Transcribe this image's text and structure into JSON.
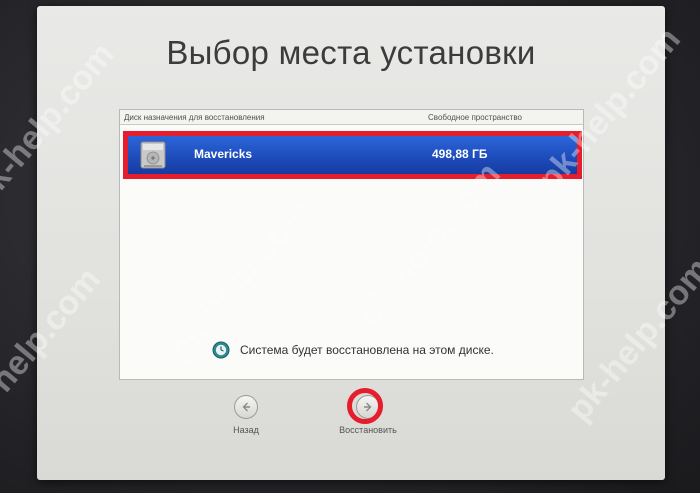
{
  "window": {
    "title": "Выбор места установки"
  },
  "disk_list": {
    "header_disk": "Диск назначения для восстановления",
    "header_free": "Свободное пространство",
    "rows": [
      {
        "name": "Mavericks",
        "free_space": "498,88 ГБ",
        "selected": true,
        "icon": "hard-drive-icon"
      }
    ]
  },
  "status": {
    "icon": "time-machine-icon",
    "text": "Система будет восстановлена на этом диске."
  },
  "navigation": {
    "back_label": "Назад",
    "next_label": "Восстановить"
  },
  "watermark": {
    "text": "pk-help.com"
  },
  "colors": {
    "selection": "#1f4fbf",
    "highlight_annotation": "#e51d2c"
  }
}
